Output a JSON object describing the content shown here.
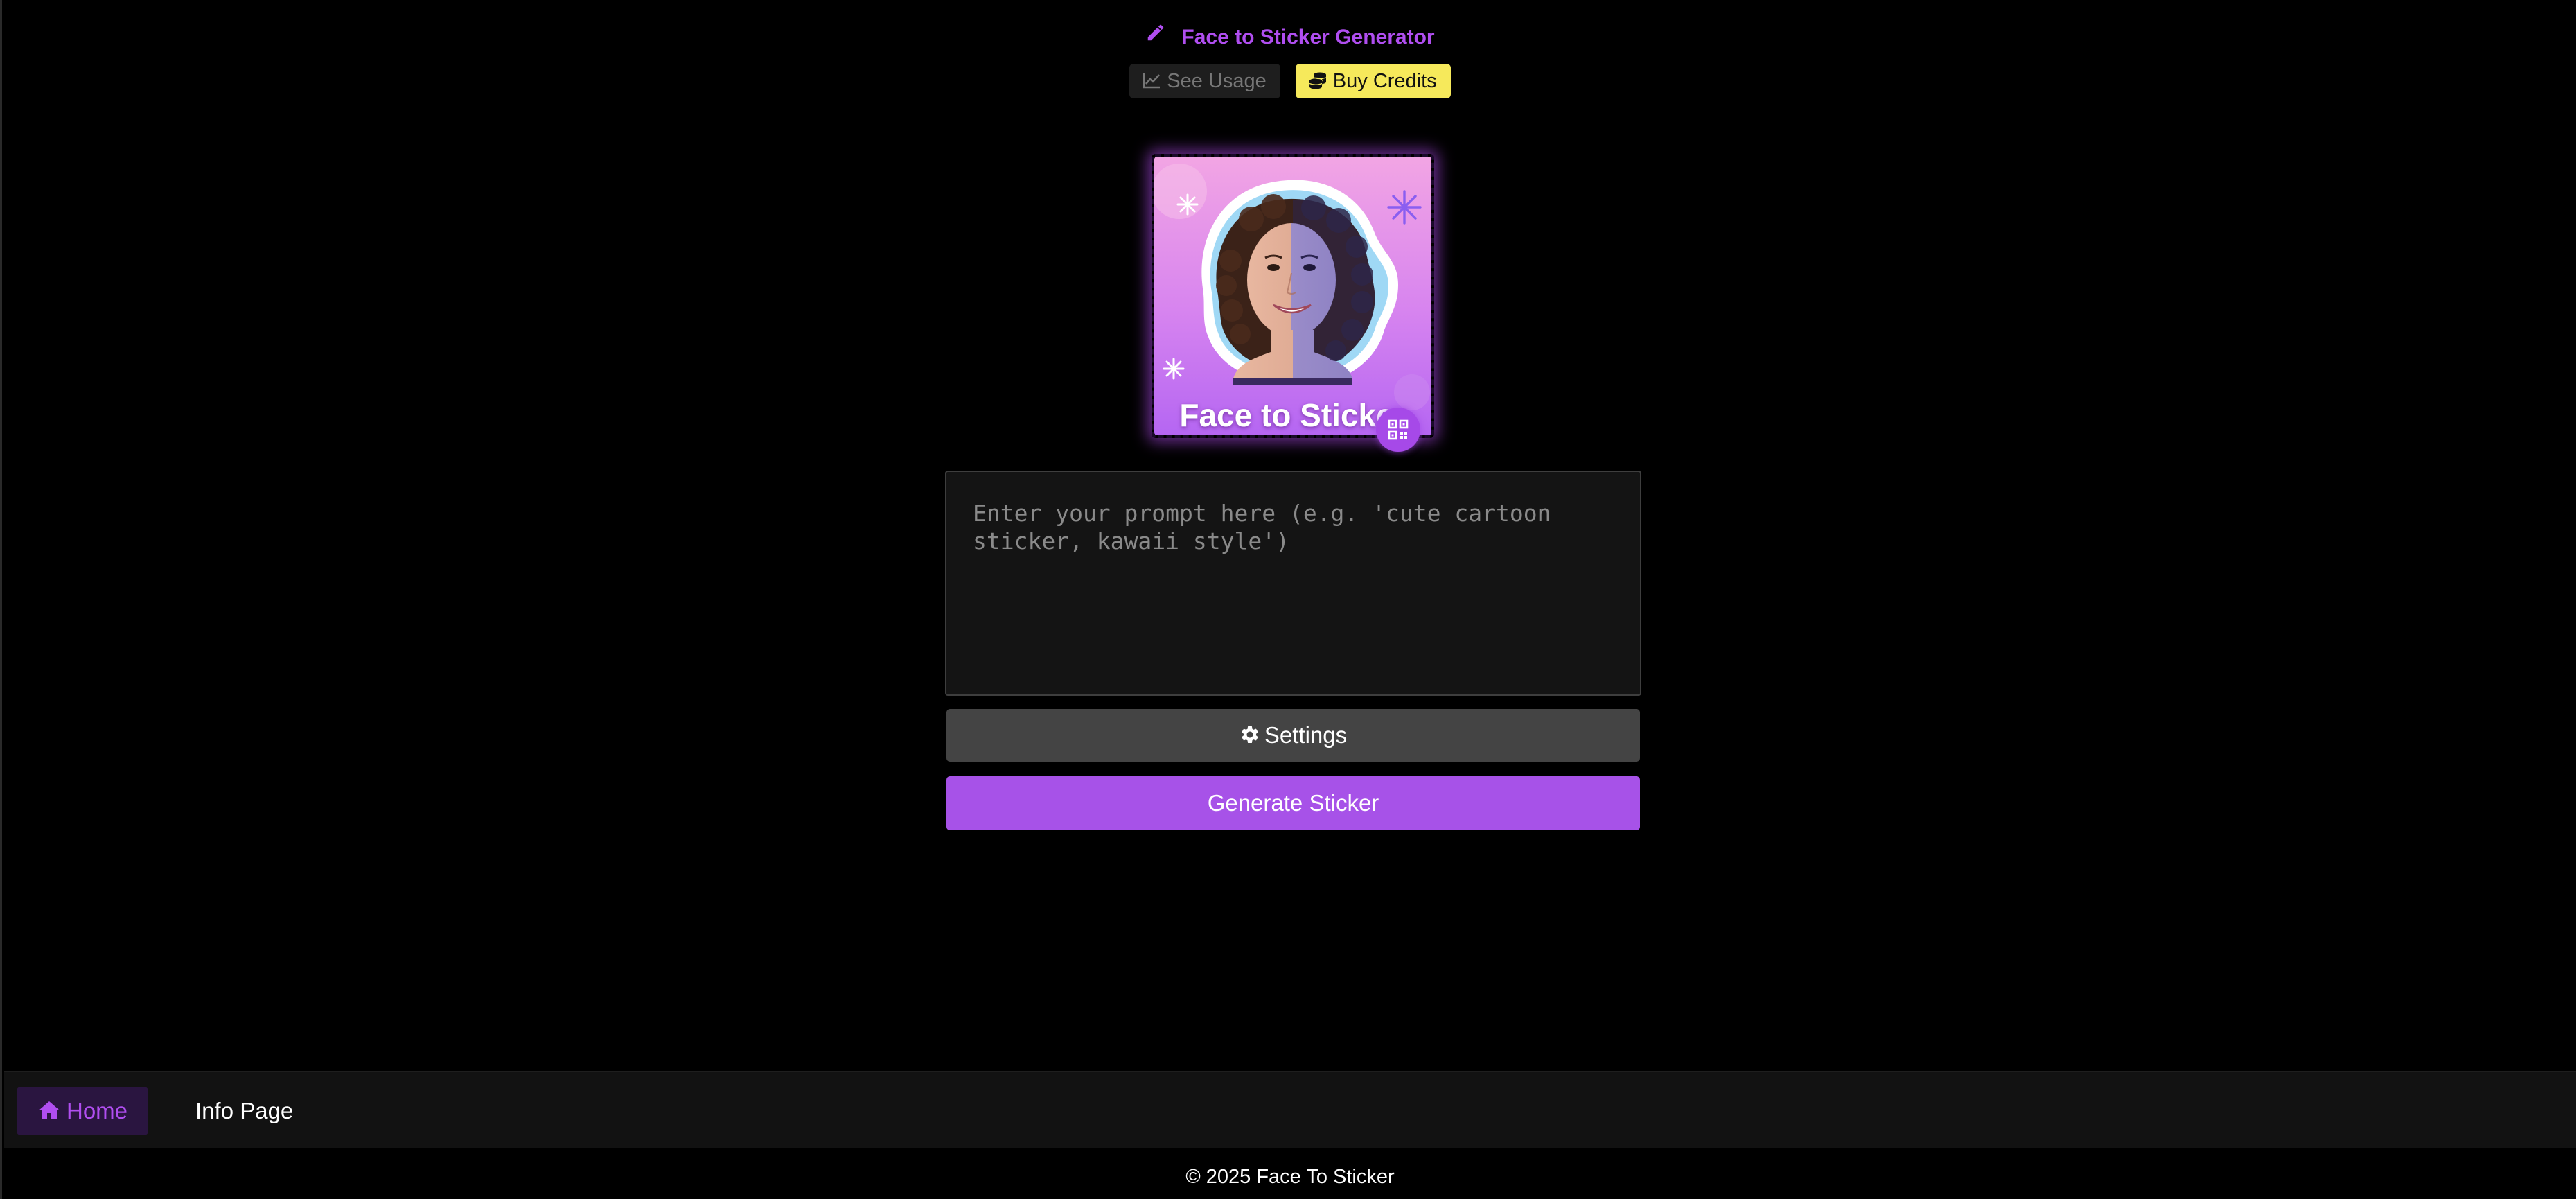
{
  "header": {
    "title": "Face to Sticker Generator",
    "see_usage_label": "See Usage",
    "buy_credits_label": "Buy Credits"
  },
  "sticker_preview": {
    "caption": "Face to Sticker"
  },
  "prompt": {
    "value": "",
    "placeholder": "Enter your prompt here (e.g. 'cute cartoon sticker, kawaii style')"
  },
  "actions": {
    "settings_label": "Settings",
    "generate_label": "Generate Sticker"
  },
  "nav": {
    "home_label": "Home",
    "info_label": "Info Page"
  },
  "footer": {
    "copyright": "© 2025 Face To Sticker"
  },
  "icons": {
    "title": "pencil-icon",
    "usage": "chart-line-icon",
    "credits": "coins-icon",
    "image_action": "qr-code-icon",
    "settings": "gear-icon",
    "home": "home-icon"
  },
  "colors": {
    "accent": "#b04ef0",
    "generate_button": "#a752e8",
    "buy_credits": "#f6e95b",
    "settings_button": "#444444",
    "background": "#000000"
  }
}
